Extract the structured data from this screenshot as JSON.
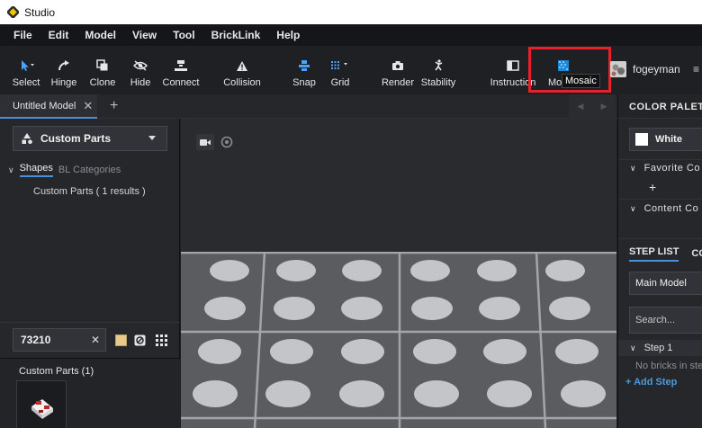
{
  "window": {
    "title": "Studio"
  },
  "menu": [
    "File",
    "Edit",
    "Model",
    "View",
    "Tool",
    "BrickLink",
    "Help"
  ],
  "toolbar": {
    "select": "Select",
    "hinge": "Hinge",
    "clone": "Clone",
    "hide": "Hide",
    "connect": "Connect",
    "collision": "Collision",
    "snap": "Snap",
    "grid": "Grid",
    "render": "Render",
    "stability": "Stability",
    "instruction": "Instruction",
    "mosaic": "Mo",
    "tooltip": "Mosaic",
    "highlight_color": "#e8202a"
  },
  "user": {
    "name": "fogeyman"
  },
  "tabs": {
    "active": "Untitled Model"
  },
  "left": {
    "category": "Custom Parts",
    "subtabs": {
      "shapes": "Shapes",
      "bl": "BL Categories"
    },
    "results": "Custom Parts ( 1 results )",
    "search_value": "73210",
    "color_swatch": "#e9c88a",
    "parts_title": "Custom Parts (1)"
  },
  "right": {
    "palette_header": "COLOR PALETTE",
    "selected_color": "White",
    "favorite": "Favorite Co",
    "content": "Content Co",
    "step_tabs": {
      "active": "STEP LIST",
      "other": "CO"
    },
    "model": "Main Model",
    "search_placeholder": "Search...",
    "step": "Step 1",
    "empty": "No bricks in step",
    "add_step": "+ Add Step"
  },
  "colors": {
    "accent": "#4a90d9",
    "link": "#4a9ade"
  }
}
